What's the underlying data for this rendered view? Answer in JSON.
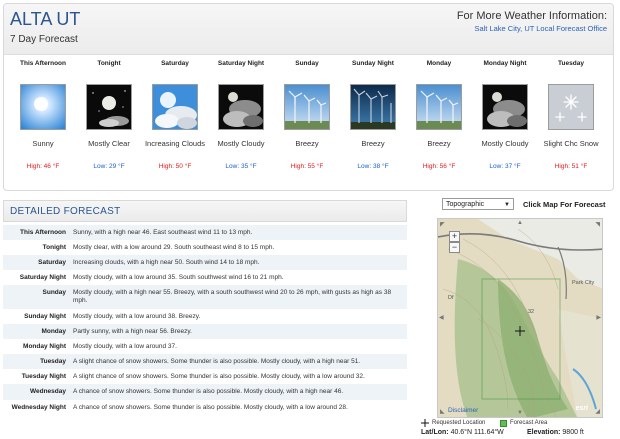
{
  "header": {
    "location": "ALTA UT",
    "subtitle": "7 Day Forecast",
    "more_info": "For More Weather Information:",
    "office_link": "Salt Lake City, UT Local Forecast Office"
  },
  "periods": [
    {
      "name": "This Afternoon",
      "icon": "sunny-icon",
      "desc": "Sunny",
      "temp": "High: 46 °F",
      "kind": "hi"
    },
    {
      "name": "Tonight",
      "icon": "clear-night-icon",
      "desc": "Mostly Clear",
      "temp": "Low: 29 °F",
      "kind": "lo"
    },
    {
      "name": "Saturday",
      "icon": "increasing-clouds-icon",
      "desc": "Increasing Clouds",
      "temp": "High: 50 °F",
      "kind": "hi"
    },
    {
      "name": "Saturday Night",
      "icon": "cloudy-night-icon",
      "desc": "Mostly Cloudy",
      "temp": "Low: 35 °F",
      "kind": "lo"
    },
    {
      "name": "Sunday",
      "icon": "breezy-wind-turbines-icon",
      "desc": "Breezy",
      "temp": "High: 55 °F",
      "kind": "hi"
    },
    {
      "name": "Sunday Night",
      "icon": "breezy-night-wind-turbines-icon",
      "desc": "Breezy",
      "temp": "Low: 38 °F",
      "kind": "lo"
    },
    {
      "name": "Monday",
      "icon": "breezy-wind-turbines-icon",
      "desc": "Breezy",
      "temp": "High: 56 °F",
      "kind": "hi"
    },
    {
      "name": "Monday Night",
      "icon": "cloudy-night-icon",
      "desc": "Mostly Cloudy",
      "temp": "Low: 37 °F",
      "kind": "lo"
    },
    {
      "name": "Tuesday",
      "icon": "snow-icon",
      "desc": "Slight Chc Snow",
      "temp": "High: 51 °F",
      "kind": "hi"
    }
  ],
  "detailed": {
    "title": "DETAILED FORECAST",
    "rows": [
      {
        "label": "This Afternoon",
        "text": "Sunny, with a high near 46. East southeast wind 11 to 13 mph."
      },
      {
        "label": "Tonight",
        "text": "Mostly clear, with a low around 29. South southeast wind 8 to 15 mph."
      },
      {
        "label": "Saturday",
        "text": "Increasing clouds, with a high near 50. South wind 14 to 18 mph."
      },
      {
        "label": "Saturday Night",
        "text": "Mostly cloudy, with a low around 35. South southwest wind 16 to 21 mph."
      },
      {
        "label": "Sunday",
        "text": "Mostly cloudy, with a high near 55. Breezy, with a south southwest wind 20 to 26 mph, with gusts as high as 38 mph."
      },
      {
        "label": "Sunday Night",
        "text": "Mostly cloudy, with a low around 38. Breezy."
      },
      {
        "label": "Monday",
        "text": "Partly sunny, with a high near 56. Breezy."
      },
      {
        "label": "Monday Night",
        "text": "Mostly cloudy, with a low around 37."
      },
      {
        "label": "Tuesday",
        "text": "A slight chance of snow showers. Some thunder is also possible. Mostly cloudy, with a high near 51."
      },
      {
        "label": "Tuesday Night",
        "text": "A slight chance of snow showers. Some thunder is also possible. Mostly cloudy, with a low around 32."
      },
      {
        "label": "Wednesday",
        "text": "A chance of snow showers. Some thunder is also possible. Mostly cloudy, with a high near 46."
      },
      {
        "label": "Wednesday Night",
        "text": "A chance of snow showers. Some thunder is also possible. Mostly cloudy, with a low around 28."
      }
    ]
  },
  "map": {
    "select_value": "Topographic",
    "click_label": "Click Map For Forecast",
    "disclaimer": "Disclaimer",
    "esri": "esri",
    "zoom_in": "+",
    "zoom_out": "−",
    "labels": [
      "Park City",
      "Df",
      "32"
    ],
    "legend_requested": "Requested Location",
    "legend_area": "Forecast Area",
    "latlon_label": "Lat/Lon:",
    "latlon_value": "40.6°N 111.64°W",
    "elevation_label": "Elevation:",
    "elevation_value": "9800 ft"
  },
  "colors": {
    "title_blue": "#2a5590",
    "high_red": "#e31b1b",
    "low_blue": "#1a5fd1",
    "row_alt": "#eef3f8"
  }
}
